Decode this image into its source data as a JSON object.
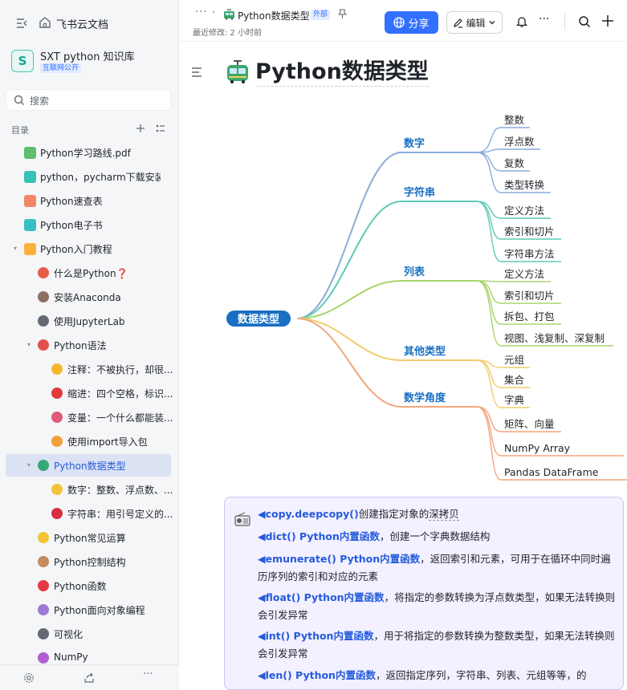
{
  "sidebar": {
    "product_name": "飞书云文档",
    "kb_avatar": "S",
    "kb_name": "SXT python 知识库",
    "kb_badge": "互联网公开",
    "search_placeholder": "搜索",
    "toc_title": "目录",
    "items": [
      {
        "label": "Python学习路线.pdf",
        "icon": "pdf-file-icon"
      },
      {
        "label": "python，pycharm下载安装数...",
        "icon": "doc-icon"
      },
      {
        "label": "Python速查表",
        "icon": "sheet-icon"
      },
      {
        "label": "Python电子书",
        "icon": "ebook-icon"
      },
      {
        "label": "Python入门教程",
        "icon": "folder-icon"
      },
      {
        "label": "什么是Python❓",
        "icon": "watermelon-icon"
      },
      {
        "label": "安装Anaconda",
        "icon": "figure-icon"
      },
      {
        "label": "使用JupyterLab",
        "icon": "clock-icon"
      },
      {
        "label": "Python语法",
        "icon": "face-icon"
      },
      {
        "label": "注释：不被执行，却很...",
        "icon": "lemon-icon"
      },
      {
        "label": "缩进：四个空格，标识...",
        "icon": "phone-icon"
      },
      {
        "label": "变量：一个什么都能装...",
        "icon": "heart-box-icon"
      },
      {
        "label": "使用import导入包",
        "icon": "person-icon"
      },
      {
        "label": "Python数据类型",
        "icon": "tram-icon"
      },
      {
        "label": "数字：整数、浮点数、...",
        "icon": "cat-face-icon"
      },
      {
        "label": "字符串：用引号定义的...",
        "icon": "heart-icon"
      },
      {
        "label": "Python常见运算",
        "icon": "flower-icon"
      },
      {
        "label": "Python控制结构",
        "icon": "woman-icon"
      },
      {
        "label": "Python函数",
        "icon": "red-heart-icon"
      },
      {
        "label": "Python面向对象编程",
        "icon": "teacher-icon"
      },
      {
        "label": "可视化",
        "icon": "doc-outline-icon"
      },
      {
        "label": "NumPy",
        "icon": "princess-icon"
      }
    ]
  },
  "header": {
    "breadcrumb_more": "···",
    "doc_title": "Python数据类型",
    "external_badge": "外部",
    "last_modified": "最近修改: 2 小时前",
    "share_label": "分享",
    "edit_label": "编辑",
    "more_label": "···"
  },
  "document": {
    "title": "Python数据类型",
    "mindmap": {
      "root": "数据类型",
      "branches": [
        {
          "label": "数字",
          "color": "#8aacd8",
          "leaves": [
            "整数",
            "浮点数",
            "复数",
            "类型转换"
          ]
        },
        {
          "label": "字符串",
          "color": "#5ccab4",
          "leaves": [
            "定义方法",
            "索引和切片",
            "字符串方法"
          ]
        },
        {
          "label": "列表",
          "color": "#a7d56b",
          "leaves": [
            "定义方法",
            "索引和切片",
            "拆包、打包",
            "视图、浅复制、深复制"
          ]
        },
        {
          "label": "其他类型",
          "color": "#f0cd6a",
          "leaves": [
            "元组",
            "集合",
            "字典"
          ]
        },
        {
          "label": "数学角度",
          "color": "#f2a67c",
          "leaves": [
            "矩阵、向量",
            "NumPy Array",
            "Pandas DataFrame"
          ]
        }
      ]
    },
    "callout": {
      "lines": [
        {
          "k": "◀copy.deepcopy()",
          "t": "创建指定对象的",
          "u": "深拷贝"
        },
        {
          "k": "◀dict() Python内置函数",
          "t": "，创建一个字典数据结构"
        },
        {
          "k": "◀emunerate() Python内置函数",
          "t": "，返回索引和元素，可用于在循环中同时遍历序列的索引和对应的元素"
        },
        {
          "k": "◀float() Python内置函数",
          "t": "，将指定的参数转换为浮点数类型，如果无法转换则会引发异常"
        },
        {
          "k": "◀int() Python内置函数",
          "t": "，用于将指定的参数转换为整数类型，如果无法转换则会引发异常"
        },
        {
          "k": "◀len() Python内置函数",
          "t": "，返回指定序列，字符串、列表、元组等等，的"
        }
      ]
    }
  },
  "colors": {
    "accent": "#3370ff",
    "mindmap_root": "#1a6fc2",
    "mindmap_branch_text": "#1a6fc2",
    "callout_bg": "#f3f0ff"
  }
}
